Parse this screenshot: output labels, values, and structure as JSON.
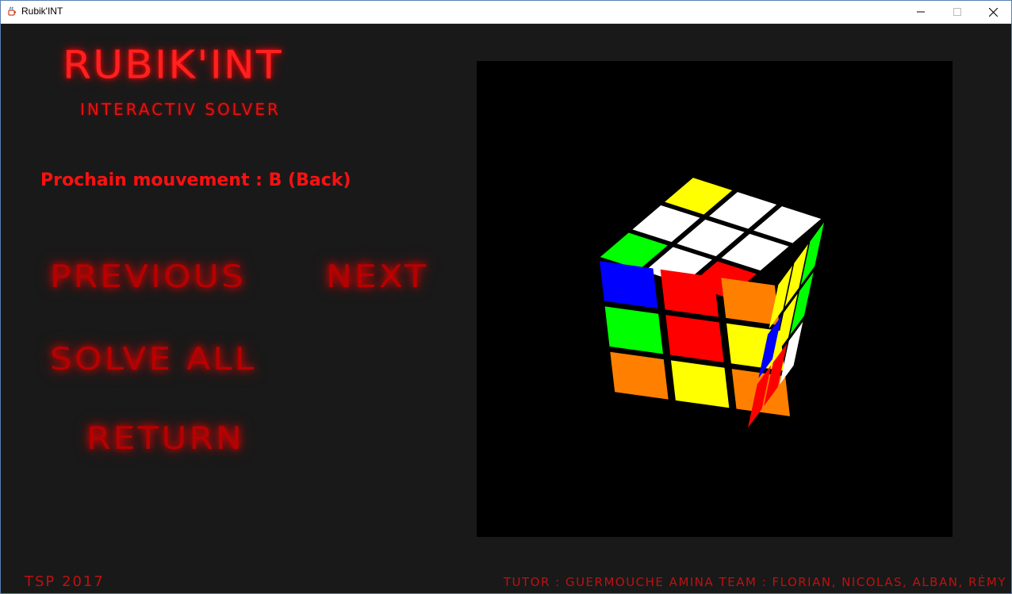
{
  "window": {
    "title": "Rubik'INT",
    "controls": {
      "minimize": "minimize",
      "maximize": "maximize",
      "close": "close"
    }
  },
  "logo": {
    "title": "RUBIK'INT",
    "subtitle": "INTERACTIV SOLVER"
  },
  "status": {
    "next_move": "Prochain mouvement : B (Back)"
  },
  "menu": {
    "previous": "PREVIOUS",
    "next": "NEXT",
    "solve_all": "SOLVE ALL",
    "return": "RETURN"
  },
  "footer": {
    "left": "TSP 2017",
    "right": "TUTOR : GUERMOUCHE AMINA   TEAM : FLORIAN, NICOLAS, ALBAN, RÉMY"
  },
  "colors": {
    "neon_red": "#ff1a1a",
    "background": "#191919",
    "viewport": "#000000"
  },
  "cube": {
    "top_face": [
      "green",
      "white",
      "red",
      "white",
      "white",
      "white",
      "yellow",
      "white",
      "white"
    ],
    "front_face": [
      "blue",
      "red",
      "orange",
      "green",
      "red",
      "yellow",
      "orange",
      "yellow",
      "orange"
    ],
    "right_face": [
      "yellow",
      "yellow",
      "green",
      "blue",
      "yellow",
      "green",
      "red",
      "red",
      "white"
    ]
  }
}
